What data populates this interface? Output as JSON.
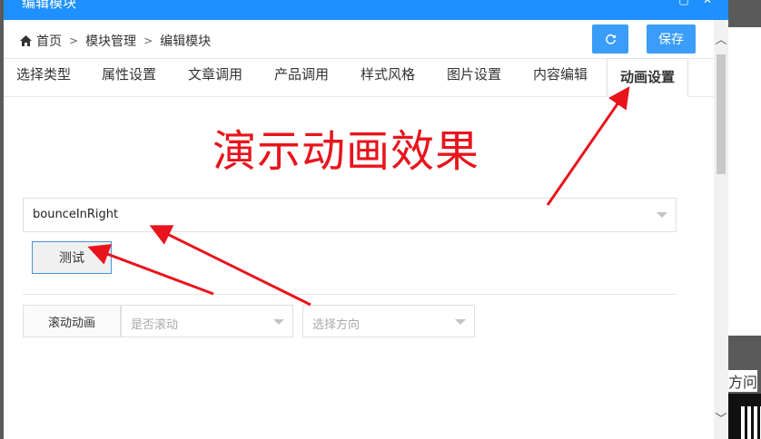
{
  "dialog": {
    "title": "编辑模块"
  },
  "breadcrumb": {
    "home": "首页",
    "level1": "模块管理",
    "level2": "编辑模块",
    "separator": ">"
  },
  "toolbar": {
    "refresh_icon": "refresh-icon",
    "save_label": "保存"
  },
  "tabs": [
    {
      "label": "选择类型"
    },
    {
      "label": "属性设置"
    },
    {
      "label": "文章调用"
    },
    {
      "label": "产品调用"
    },
    {
      "label": "样式风格"
    },
    {
      "label": "图片设置"
    },
    {
      "label": "内容编辑"
    },
    {
      "label": "动画设置",
      "active": true
    }
  ],
  "annotation": {
    "text": "演示动画效果",
    "color": "#e8141c"
  },
  "animation_select": {
    "value": "bounceInRight"
  },
  "test_button": {
    "label": "测试"
  },
  "scroll_animation": {
    "label": "滚动动画",
    "scroll_placeholder": "是否滚动",
    "direction_placeholder": "选择方向"
  },
  "background": {
    "partial_text": "方问"
  },
  "colors": {
    "accent": "#1e90ff",
    "button": "#3a9df9",
    "annotation_red": "#e8141c"
  }
}
